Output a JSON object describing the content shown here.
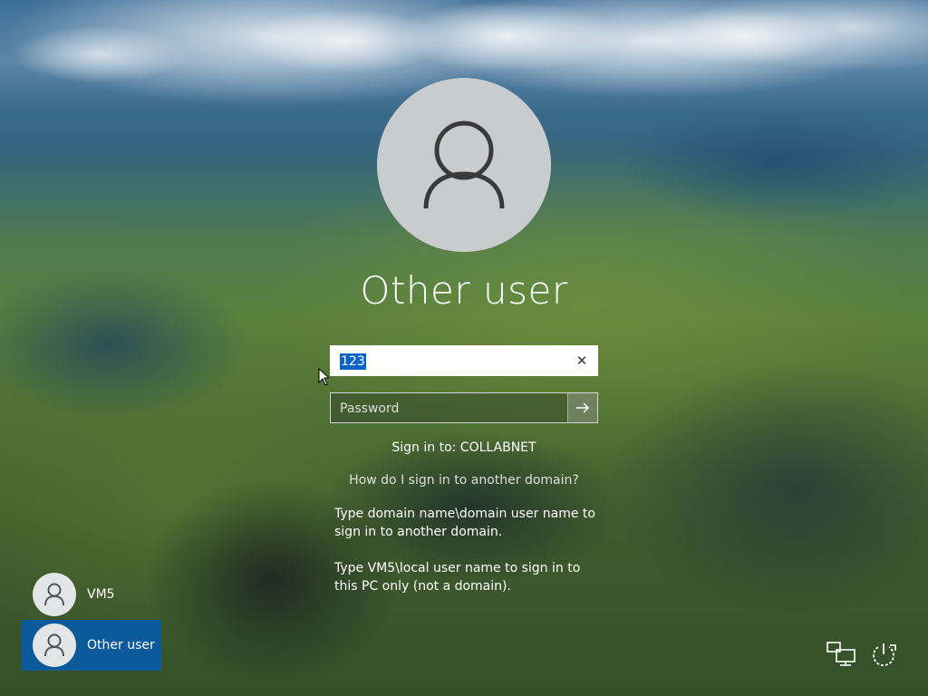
{
  "screen": {
    "type": "Windows sign-in"
  },
  "current_user": {
    "name": "Other user"
  },
  "username_field": {
    "value": "123",
    "selected": true
  },
  "password_field": {
    "placeholder": "Password",
    "value": ""
  },
  "sign_in_to": "Sign in to: COLLABNET",
  "help": {
    "link": "How do I sign in to another domain?",
    "paragraph1": "Type domain name\\domain user name to sign in to another domain.",
    "paragraph2": "Type VM5\\local user name to sign in to this PC only (not a domain)."
  },
  "user_tiles": [
    {
      "label": "VM5",
      "selected": false
    },
    {
      "label": "Other user",
      "selected": true
    }
  ],
  "icons": {
    "avatar": "user-icon",
    "clear": "close-icon",
    "submit": "arrow-right-icon",
    "network": "network-icon",
    "power": "power-icon"
  },
  "colors": {
    "selection": "#0a64c8",
    "selected_tile": "#0a5a9c",
    "avatar_bg": "#c9ccce"
  }
}
